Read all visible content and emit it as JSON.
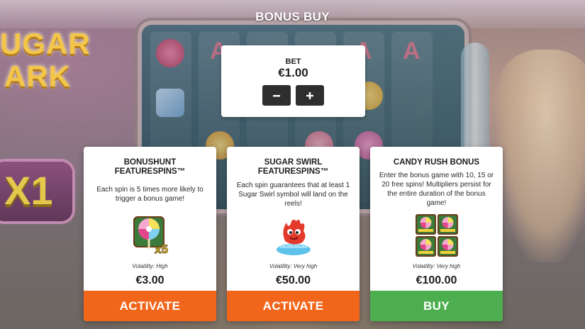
{
  "screen": {
    "title": "BONUS BUY"
  },
  "background": {
    "logo_line1": "UGAR",
    "logo_line2": "ARK",
    "multiplier": "X1",
    "reel_letters": [
      "A",
      "A",
      "A"
    ]
  },
  "bet": {
    "label": "BET",
    "value": "€1.00",
    "decrease_icon": "minus-icon",
    "increase_icon": "plus-icon"
  },
  "cards": [
    {
      "title_line1": "BONUSHUNT",
      "title_line2": "FEATURESPINS™",
      "description": "Each spin is 5 times more likely to trigger a bonus game!",
      "art_icon": "lollipop-x5-icon",
      "art_badge": "x5",
      "volatility": "Volatility: High",
      "price": "€3.00",
      "button_label": "ACTIVATE",
      "button_color": "#f2661b"
    },
    {
      "title_line1": "SUGAR SWIRL",
      "title_line2": "FEATURESPINS™",
      "description": "Each spin guarantees that at least 1 Sugar Swirl symbol will land on the reels!",
      "art_icon": "sugar-swirl-character-icon",
      "volatility": "Volatility: Very high",
      "price": "€50.00",
      "button_label": "ACTIVATE",
      "button_color": "#f2661b"
    },
    {
      "title_line1": "CANDY RUSH BONUS",
      "title_line2": "",
      "description": "Enter the bonus game with 10, 15 or 20 free spins! Multipliers persist for the entire duration of the bonus game!",
      "art_icon": "four-scatter-symbols-icon",
      "volatility": "Volatility: Very high",
      "price": "€100.00",
      "button_label": "BUY",
      "button_color": "#4cae4f"
    }
  ]
}
